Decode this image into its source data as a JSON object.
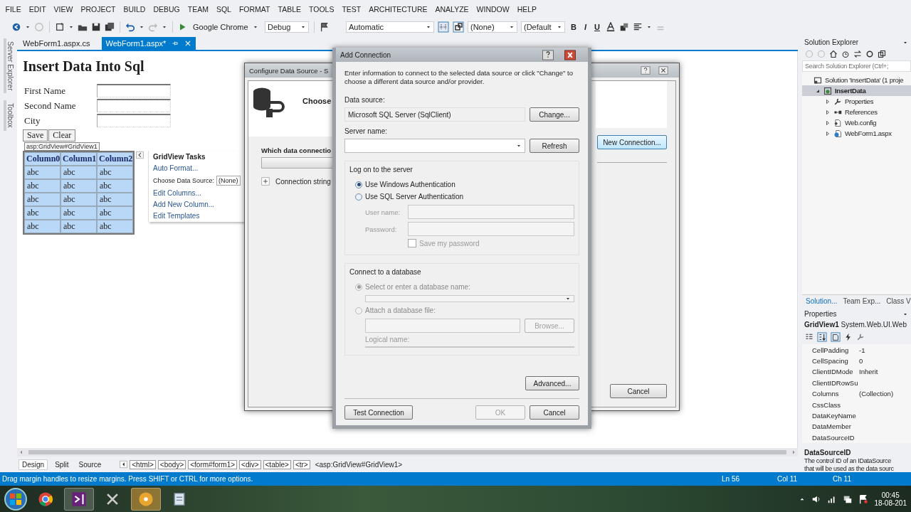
{
  "menu": [
    "FILE",
    "EDIT",
    "VIEW",
    "PROJECT",
    "BUILD",
    "DEBUG",
    "TEAM",
    "SQL",
    "FORMAT",
    "TABLE",
    "TOOLS",
    "TEST",
    "ARCHITECTURE",
    "ANALYZE",
    "WINDOW",
    "HELP"
  ],
  "toolbar": {
    "browser": "Google Chrome",
    "config": "Debug",
    "target": "Automatic",
    "style": "(None)",
    "font": "(Default",
    "format_buttons": [
      "B",
      "I",
      "U"
    ]
  },
  "side_tabs": [
    "Server Explorer",
    "Toolbox"
  ],
  "document_tabs": [
    {
      "label": "WebForm1.aspx.cs",
      "selected": false
    },
    {
      "label": "WebForm1.aspx*",
      "selected": true
    }
  ],
  "designer": {
    "heading": "Insert Data Into Sql",
    "form_labels": [
      "First Name",
      "Second Name",
      "City"
    ],
    "buttons": [
      "Save",
      "Clear"
    ],
    "gridview_tag": "asp:GridView#GridView1",
    "grid": {
      "columns": [
        "Column0",
        "Column1",
        "Column2"
      ],
      "rows": [
        [
          "abc",
          "abc",
          "abc"
        ],
        [
          "abc",
          "abc",
          "abc"
        ],
        [
          "abc",
          "abc",
          "abc"
        ],
        [
          "abc",
          "abc",
          "abc"
        ],
        [
          "abc",
          "abc",
          "abc"
        ]
      ]
    },
    "tasks": {
      "title": "GridView Tasks",
      "items": [
        {
          "kind": "link",
          "label": "Auto Format..."
        },
        {
          "kind": "select",
          "label": "Choose Data Source:",
          "value": "(None)"
        },
        {
          "kind": "link",
          "label": "Edit Columns..."
        },
        {
          "kind": "link",
          "label": "Add New Column..."
        },
        {
          "kind": "link",
          "label": "Edit Templates"
        }
      ]
    }
  },
  "view_bar": {
    "views": [
      {
        "label": "Design",
        "selected": true
      },
      {
        "label": "Split",
        "selected": false
      },
      {
        "label": "Source",
        "selected": false
      }
    ],
    "breadcrumbs": [
      "<html>",
      "<body>",
      "<form#form1>",
      "<div>",
      "<table>",
      "<tr>"
    ],
    "current": "<asp:GridView#GridView1>"
  },
  "configure_dialog": {
    "title": "Configure Data Source - S",
    "heading": "Choose",
    "question": "Which data connectio",
    "connection_string": "Connection string",
    "new_connection": "New Connection...",
    "cancel": "Cancel"
  },
  "add_connection": {
    "title": "Add Connection",
    "intro": "Enter information to connect to the selected data source or click \"Change\" to choose a different data source and/or provider.",
    "data_source_label": "Data source:",
    "data_source": "Microsoft SQL Server (SqlClient)",
    "change": "Change...",
    "server_label": "Server name:",
    "refresh": "Refresh",
    "logon": {
      "title": "Log on to the server",
      "options": [
        {
          "label": "Use Windows Authentication",
          "selected": true
        },
        {
          "label": "Use SQL Server Authentication",
          "selected": false
        }
      ],
      "user_label": "User name:",
      "password_label": "Password:",
      "credentials_disabled": true,
      "save_password": {
        "label": "Save my password",
        "checked": false
      }
    },
    "database": {
      "title": "Connect to a database",
      "disabled": true,
      "options": [
        {
          "label": "Select or enter a database name:",
          "selected": true
        },
        {
          "label": "Attach a database file:",
          "selected": false
        }
      ],
      "browse": "Browse...",
      "logical_label": "Logical name:"
    },
    "advanced": "Advanced...",
    "test": "Test Connection",
    "ok": {
      "label": "OK",
      "disabled": true
    },
    "cancel": "Cancel"
  },
  "solution_explorer": {
    "title": "Solution Explorer",
    "search": "Search Solution Explorer (Ctrl+;",
    "tree": [
      {
        "kind": "solution",
        "label": "Solution 'InsertData' (1 proje",
        "selected": false,
        "children": [
          {
            "kind": "project",
            "label": "InsertData",
            "selected": true,
            "expanded": true,
            "children": [
              {
                "kind": "properties",
                "label": "Properties",
                "selected": false,
                "expanded": false
              },
              {
                "kind": "references",
                "label": "References",
                "selected": false,
                "expanded": false
              },
              {
                "kind": "config",
                "label": "Web.config",
                "selected": false,
                "expanded": false
              },
              {
                "kind": "page",
                "label": "WebForm1.aspx",
                "selected": false,
                "expanded": false
              }
            ]
          }
        ]
      }
    ]
  },
  "panel_tabs": [
    {
      "label": "Solution...",
      "selected": true
    },
    {
      "label": "Team Exp...",
      "selected": false
    },
    {
      "label": "Class V",
      "selected": false
    }
  ],
  "properties": {
    "title": "Properties",
    "object": "GridView1",
    "type": "System.Web.UI.Web",
    "rows": [
      {
        "name": "CellPadding",
        "value": "-1"
      },
      {
        "name": "CellSpacing",
        "value": "0"
      },
      {
        "name": "ClientIDMode",
        "value": "Inherit"
      },
      {
        "name": "ClientIDRowSu"
      },
      {
        "name": "Columns",
        "value": "(Collection)"
      },
      {
        "name": "CssClass"
      },
      {
        "name": "DataKeyName"
      },
      {
        "name": "DataMember"
      },
      {
        "name": "DataSourceID"
      }
    ],
    "description_title": "DataSourceID",
    "description_lines": [
      "The control ID of an IDataSource",
      "that will be used as the data sourc"
    ]
  },
  "status_bar": {
    "message": "Drag margin handles to resize margins. Press SHIFT or CTRL for more options.",
    "line": "Ln 56",
    "column": "Col 11",
    "char": "Ch 11"
  },
  "taskbar": {
    "time": "00:45",
    "date": "18-08-201"
  }
}
